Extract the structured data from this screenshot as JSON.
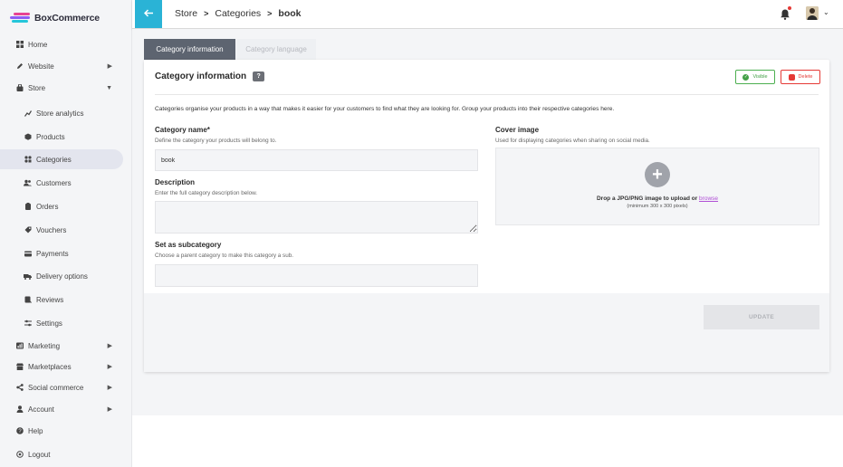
{
  "brand": {
    "name": "BoxCommerce"
  },
  "sidebar": {
    "items": [
      {
        "label": "Home",
        "icon": "grid-icon"
      },
      {
        "label": "Website",
        "icon": "pen-icon"
      },
      {
        "label": "Store",
        "icon": "bag-icon"
      },
      {
        "label": "Store analytics",
        "icon": "chart-icon"
      },
      {
        "label": "Products",
        "icon": "cube-icon"
      },
      {
        "label": "Categories",
        "icon": "categories-icon"
      },
      {
        "label": "Customers",
        "icon": "users-icon"
      },
      {
        "label": "Orders",
        "icon": "clipboard-icon"
      },
      {
        "label": "Vouchers",
        "icon": "tag-icon"
      },
      {
        "label": "Payments",
        "icon": "card-icon"
      },
      {
        "label": "Delivery options",
        "icon": "truck-icon"
      },
      {
        "label": "Reviews",
        "icon": "review-icon"
      },
      {
        "label": "Settings",
        "icon": "sliders-icon"
      },
      {
        "label": "Marketing",
        "icon": "megaphone-icon"
      },
      {
        "label": "Marketplaces",
        "icon": "shop-icon"
      },
      {
        "label": "Social commerce",
        "icon": "share-icon"
      },
      {
        "label": "Account",
        "icon": "user-icon"
      },
      {
        "label": "Help",
        "icon": "help-icon"
      },
      {
        "label": "Logout",
        "icon": "logout-icon"
      }
    ]
  },
  "header": {
    "breadcrumb": [
      "Store",
      "Categories",
      "book"
    ]
  },
  "tabs": [
    "Category information",
    "Category language"
  ],
  "card": {
    "title": "Category information",
    "help_badge": "?",
    "visible_label": "Visible",
    "delete_label": "Delete",
    "intro": "Categories organise your products in a way that makes it easier for your customers to find what they are looking for. Group your products into their respective categories here.",
    "name_label": "Category name*",
    "name_hint": "Define the category your products will belong to.",
    "name_value": "book",
    "description_label": "Description",
    "description_hint": "Enter the full category description below.",
    "description_value": "",
    "subcategory_label": "Set as subcategory",
    "subcategory_hint": "Choose a parent category to make this category a sub.",
    "subcategory_value": "",
    "cover_label": "Cover image",
    "cover_hint": "Used for displaying categories when sharing on social media.",
    "drop_text": "Drop a JPG/PNG image to upload or",
    "drop_link": "browse",
    "drop_sub": "(minimum 300 x 300 pixels)",
    "update_label": "UPDATE"
  },
  "colors": {
    "accent": "#2ab3d6",
    "active_tab": "#5d6470",
    "visible": "#43a047",
    "delete": "#e53935",
    "link": "#b04fd6"
  }
}
